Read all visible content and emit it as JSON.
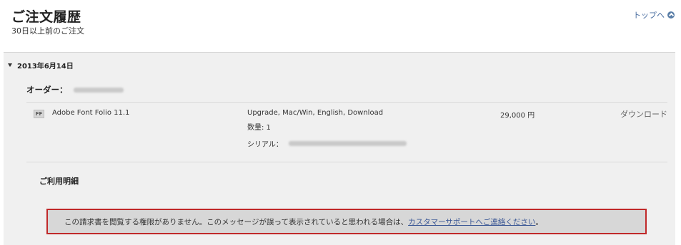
{
  "header": {
    "title": "ご注文履歴",
    "subtitle": "30日以上前のご注文",
    "top_link": "トップへ"
  },
  "order_group": {
    "date": "2013年6月14日",
    "order_label": "オーダー："
  },
  "item": {
    "icon_text": "FF",
    "name": "Adobe Font Folio 11.1",
    "description": "Upgrade, Mac/Win, English, Download",
    "quantity": "数量: 1",
    "serial_label": "シリアル：",
    "price": "29,000 円",
    "download_label": "ダウンロード"
  },
  "usage": {
    "title": "ご利用明細"
  },
  "notice": {
    "message": "この請求書を閲覧する権限がありません。このメッセージが誤って表示されていると思われる場合は、",
    "link_text": "カスタマーサポートへご連絡ください",
    "suffix": "。",
    "border_color": "#c0292a"
  }
}
